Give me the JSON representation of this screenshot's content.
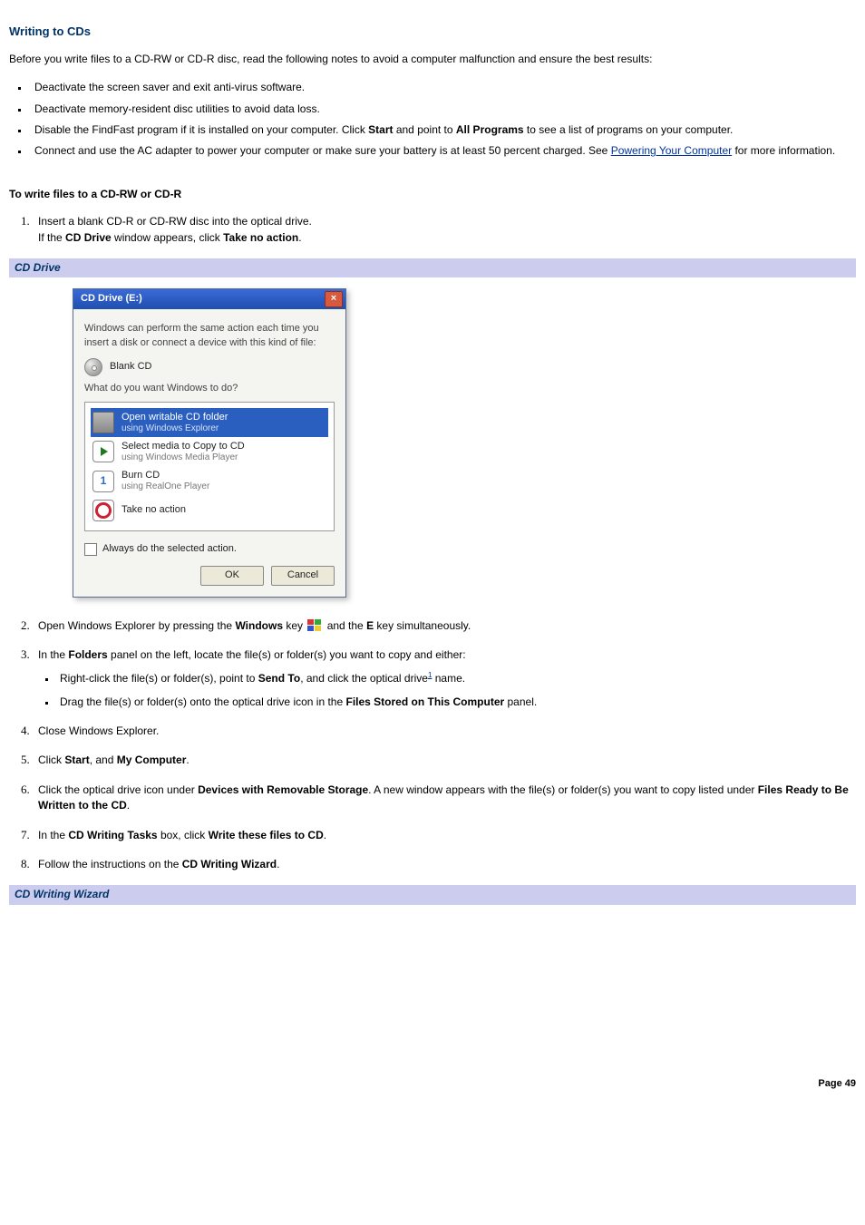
{
  "heading": "Writing to CDs",
  "intro": "Before you write files to a CD-RW or CD-R disc, read the following notes to avoid a computer malfunction and ensure the best results:",
  "bullets": {
    "b1": "Deactivate the screen saver and exit anti-virus software.",
    "b2": "Deactivate memory-resident disc utilities to avoid data loss.",
    "b3_pre": "Disable the FindFast program if it is installed on your computer. Click ",
    "b3_start": "Start",
    "b3_mid": " and point to ",
    "b3_allprograms": "All Programs",
    "b3_post": " to see a list of programs on your computer.",
    "b4_pre": "Connect and use the AC adapter to power your computer or make sure your battery is at least 50 percent charged. See ",
    "b4_link": "Powering Your Computer",
    "b4_post": " for more information."
  },
  "subheading": "To write files to a CD-RW or CD-R",
  "steps": {
    "s1_a": "Insert a blank CD-R or CD-RW disc into the optical drive.",
    "s1_b_pre": "If the ",
    "s1_b_bold": "CD Drive",
    "s1_b_mid": " window appears, click ",
    "s1_b_bold2": "Take no action",
    "s1_b_post": ".",
    "s2_pre": "Open Windows Explorer by pressing the ",
    "s2_winkey": "Windows",
    "s2_mid": " key ",
    "s2_mid2": " and the ",
    "s2_e": "E",
    "s2_post": " key simultaneously.",
    "s3_pre": "In the ",
    "s3_folders": "Folders",
    "s3_post": " panel on the left, locate the file(s) or folder(s) you want to copy and either:",
    "s3_sub1_pre": "Right-click the file(s) or folder(s), point to ",
    "s3_sub1_sendto": "Send To",
    "s3_sub1_mid": ", and click the optical drive",
    "s3_sub1_footref": "1",
    "s3_sub1_post": " name.",
    "s3_sub2_pre": "Drag the file(s) or folder(s) onto the optical drive icon in the ",
    "s3_sub2_bold": "Files Stored on This Computer",
    "s3_sub2_post": " panel.",
    "s4": "Close Windows Explorer.",
    "s5_pre": "Click ",
    "s5_start": "Start",
    "s5_mid": ", and ",
    "s5_mycomp": "My Computer",
    "s5_post": ".",
    "s6_pre": "Click the optical drive icon under ",
    "s6_b1": "Devices with Removable Storage",
    "s6_mid": ". A new window appears with the file(s) or folder(s) you want to copy listed under ",
    "s6_b2": "Files Ready to Be Written to the CD",
    "s6_post": ".",
    "s7_pre": "In the ",
    "s7_b1": "CD Writing Tasks",
    "s7_mid": " box, click ",
    "s7_b2": "Write these files to CD",
    "s7_post": ".",
    "s8_pre": "Follow the instructions on the ",
    "s8_b": "CD Writing Wizard",
    "s8_post": "."
  },
  "caption1": "CD Drive",
  "caption2": "CD Writing Wizard",
  "dialog": {
    "title": "CD Drive (E:)",
    "line1": "Windows can perform the same action each time you insert a disk or connect a device with this kind of file:",
    "blankcd": "Blank CD",
    "prompt": "What do you want Windows to do?",
    "opt1_main": "Open writable CD folder",
    "opt1_sub": "using Windows Explorer",
    "opt2_main": "Select media to Copy to CD",
    "opt2_sub": "using Windows Media Player",
    "opt3_main": "Burn CD",
    "opt3_sub": "using RealOne Player",
    "opt4_main": "Take no action",
    "checkbox": "Always do the selected action.",
    "ok": "OK",
    "cancel": "Cancel"
  },
  "page_label": "Page 49"
}
